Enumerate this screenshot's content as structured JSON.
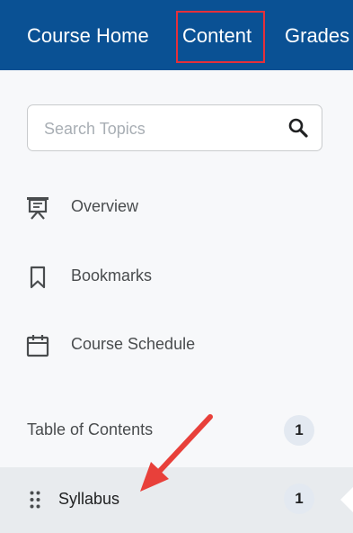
{
  "nav": {
    "items": [
      {
        "label": "Course Home"
      },
      {
        "label": "Content"
      },
      {
        "label": "Grades"
      }
    ],
    "colors": {
      "bar": "#0a5194",
      "highlight_box": "#e5303a"
    }
  },
  "sidebar": {
    "search": {
      "placeholder": "Search Topics",
      "icon": "search-icon"
    },
    "menu": [
      {
        "label": "Overview",
        "icon": "presentation-board-icon"
      },
      {
        "label": "Bookmarks",
        "icon": "bookmark-icon"
      },
      {
        "label": "Course Schedule",
        "icon": "calendar-icon"
      }
    ],
    "toc": {
      "label": "Table of Contents",
      "count": "1"
    },
    "modules": [
      {
        "label": "Syllabus",
        "count": "1",
        "icon": "drag-handle-icon"
      }
    ]
  },
  "annotation": {
    "icon": "red-arrow-icon",
    "color": "#e8403a"
  }
}
